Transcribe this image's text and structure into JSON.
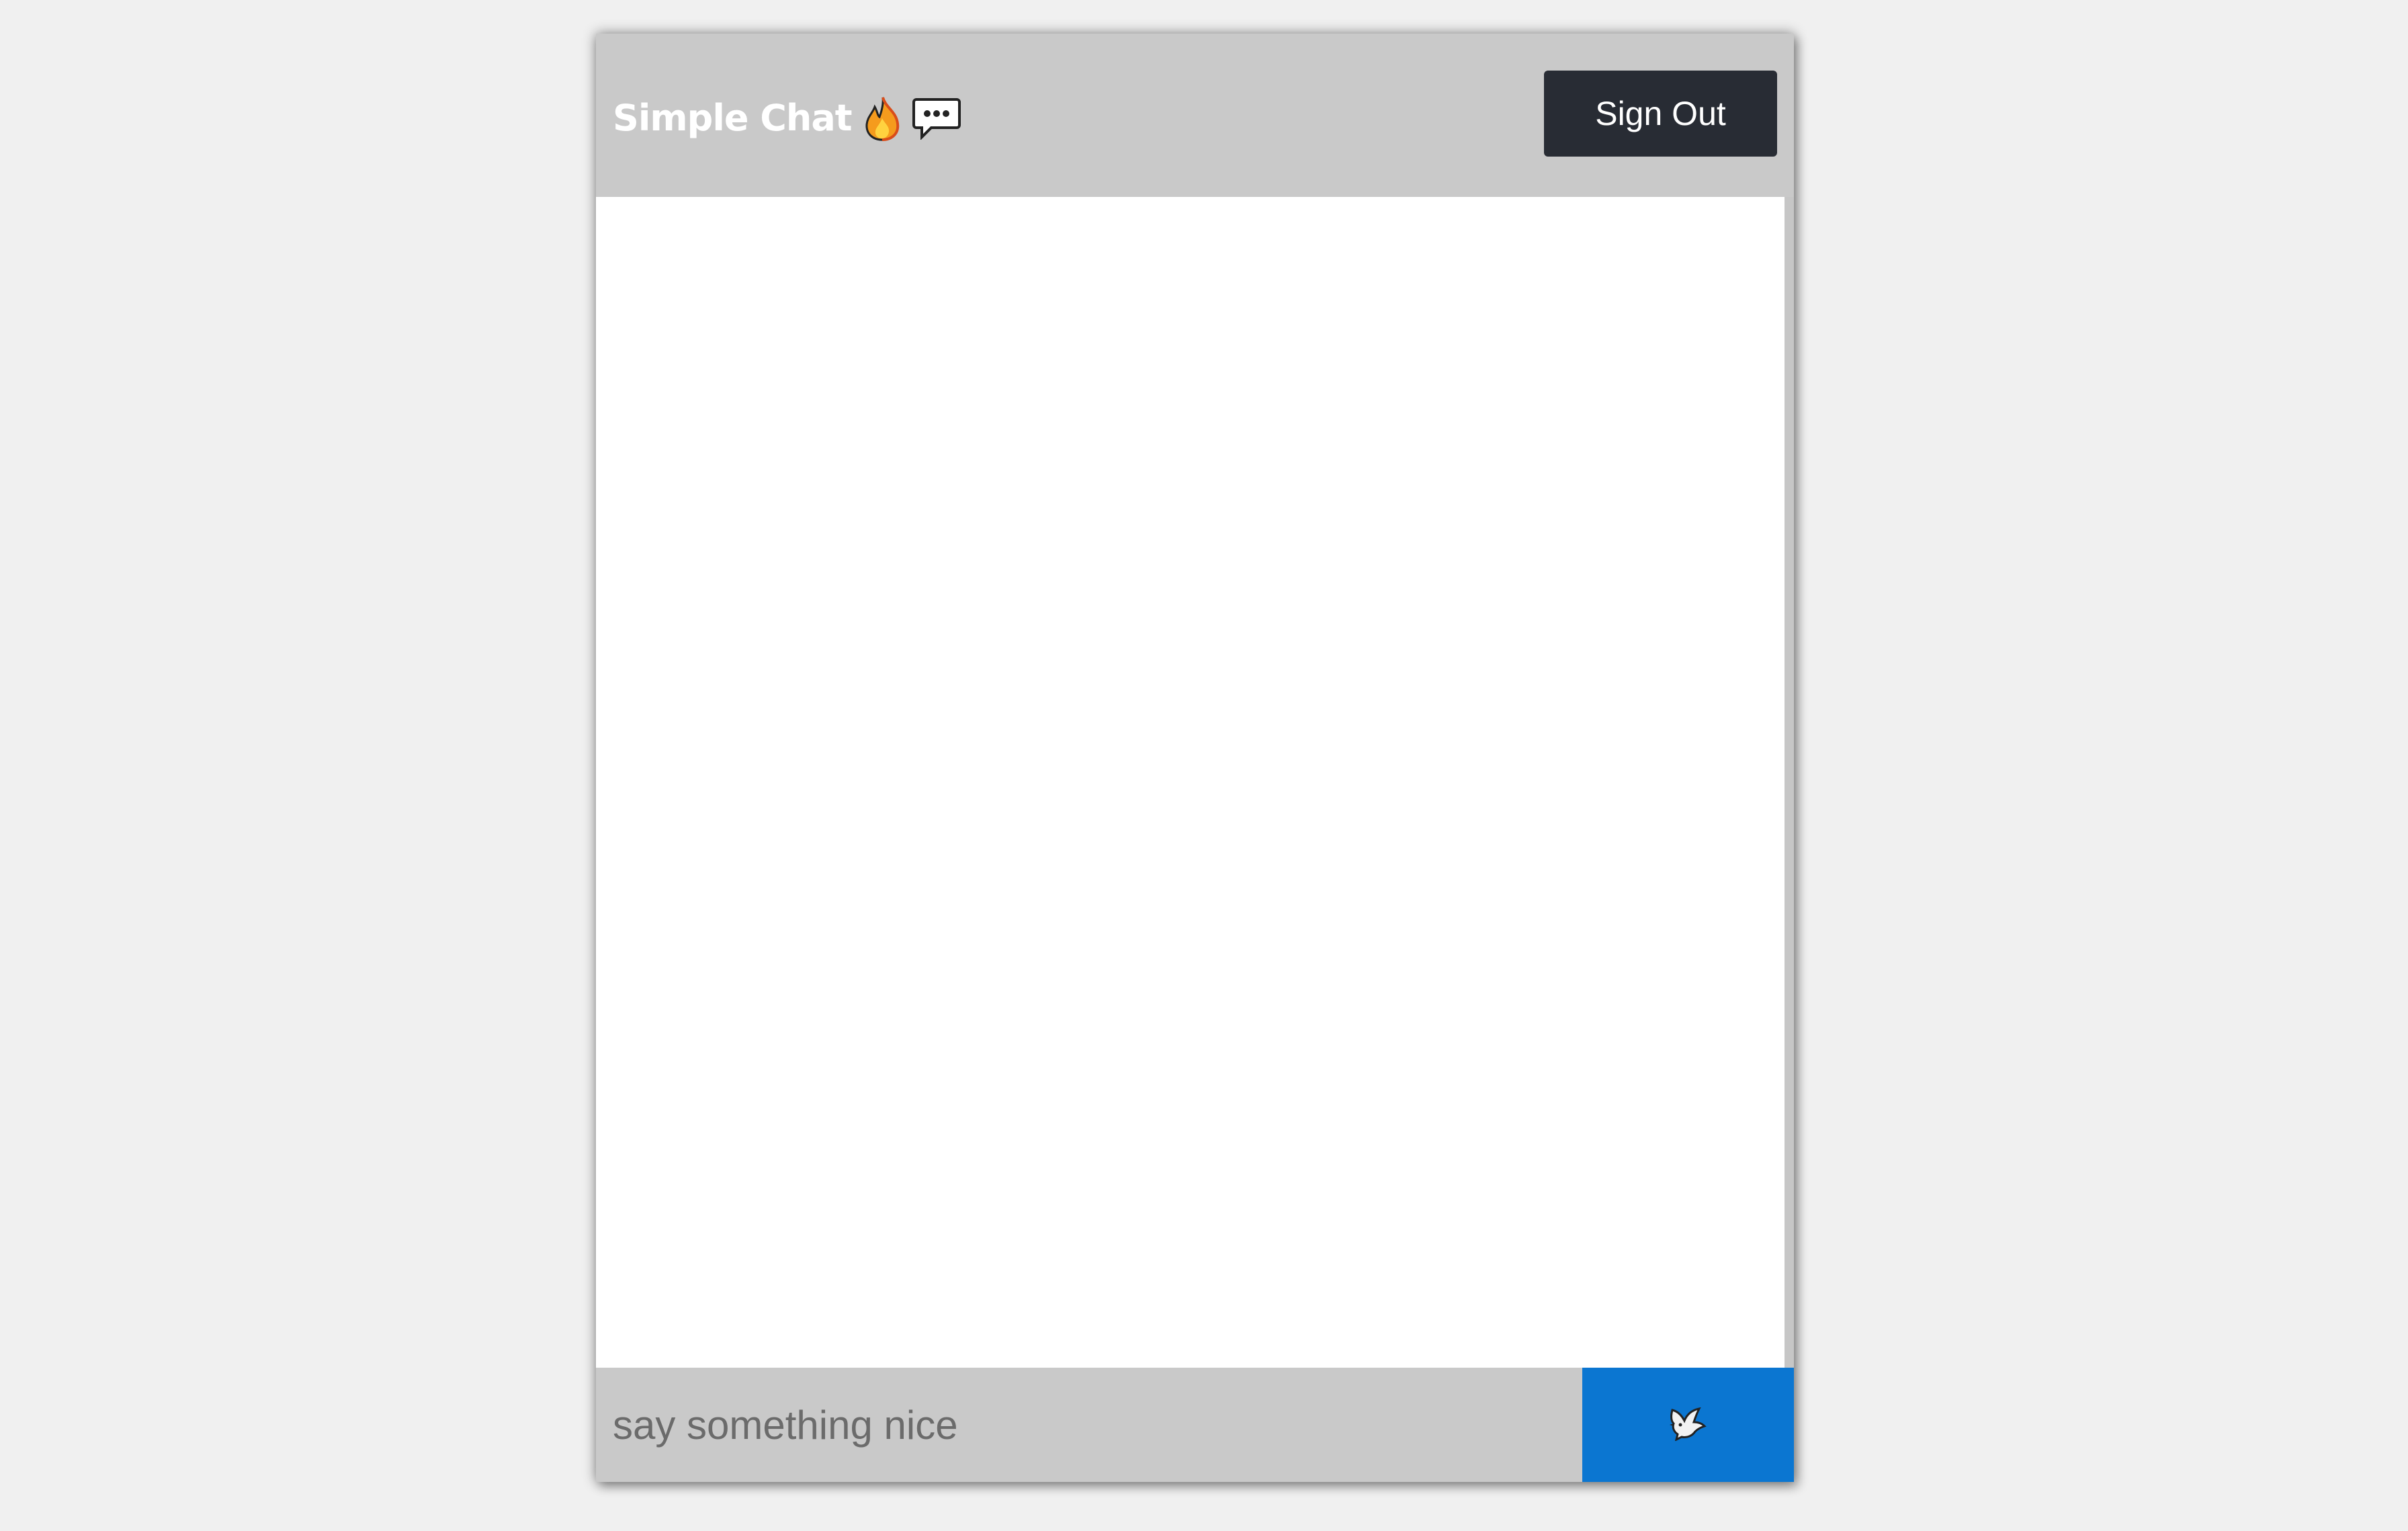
{
  "header": {
    "title": "Simple Chat",
    "title_icons": [
      "fire-icon",
      "speech-bubble-icon"
    ],
    "signout_label": "Sign Out"
  },
  "composer": {
    "placeholder": "say something nice",
    "send_icon": "dove-icon"
  },
  "colors": {
    "page_bg": "#f0f0f0",
    "header_bg": "#c9c9c9",
    "signout_bg": "#282c34",
    "send_bg": "#0b76d1"
  }
}
